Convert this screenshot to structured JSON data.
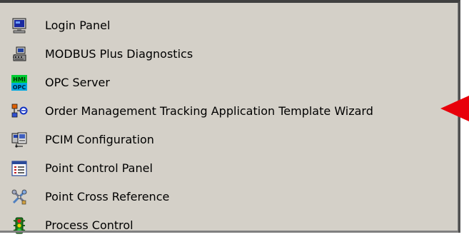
{
  "menu": {
    "items": [
      {
        "label": "Login Panel",
        "icon": "monitor-icon"
      },
      {
        "label": "MODBUS Plus Diagnostics",
        "icon": "network-device-icon"
      },
      {
        "label": "OPC Server",
        "icon": "hmi-opc-icon"
      },
      {
        "label": "Order Management Tracking Application Template Wizard",
        "icon": "workflow-icon"
      },
      {
        "label": "PCIM Configuration",
        "icon": "configuration-icon"
      },
      {
        "label": "Point Control Panel",
        "icon": "control-panel-icon"
      },
      {
        "label": "Point Cross Reference",
        "icon": "tools-icon"
      },
      {
        "label": "Process Control",
        "icon": "traffic-light-icon"
      }
    ],
    "hmi_icon_text": {
      "top": "HMI",
      "bottom": "OPC"
    }
  },
  "colors": {
    "menu_background": "#d4d0c8",
    "pointer": "#e8000a"
  }
}
